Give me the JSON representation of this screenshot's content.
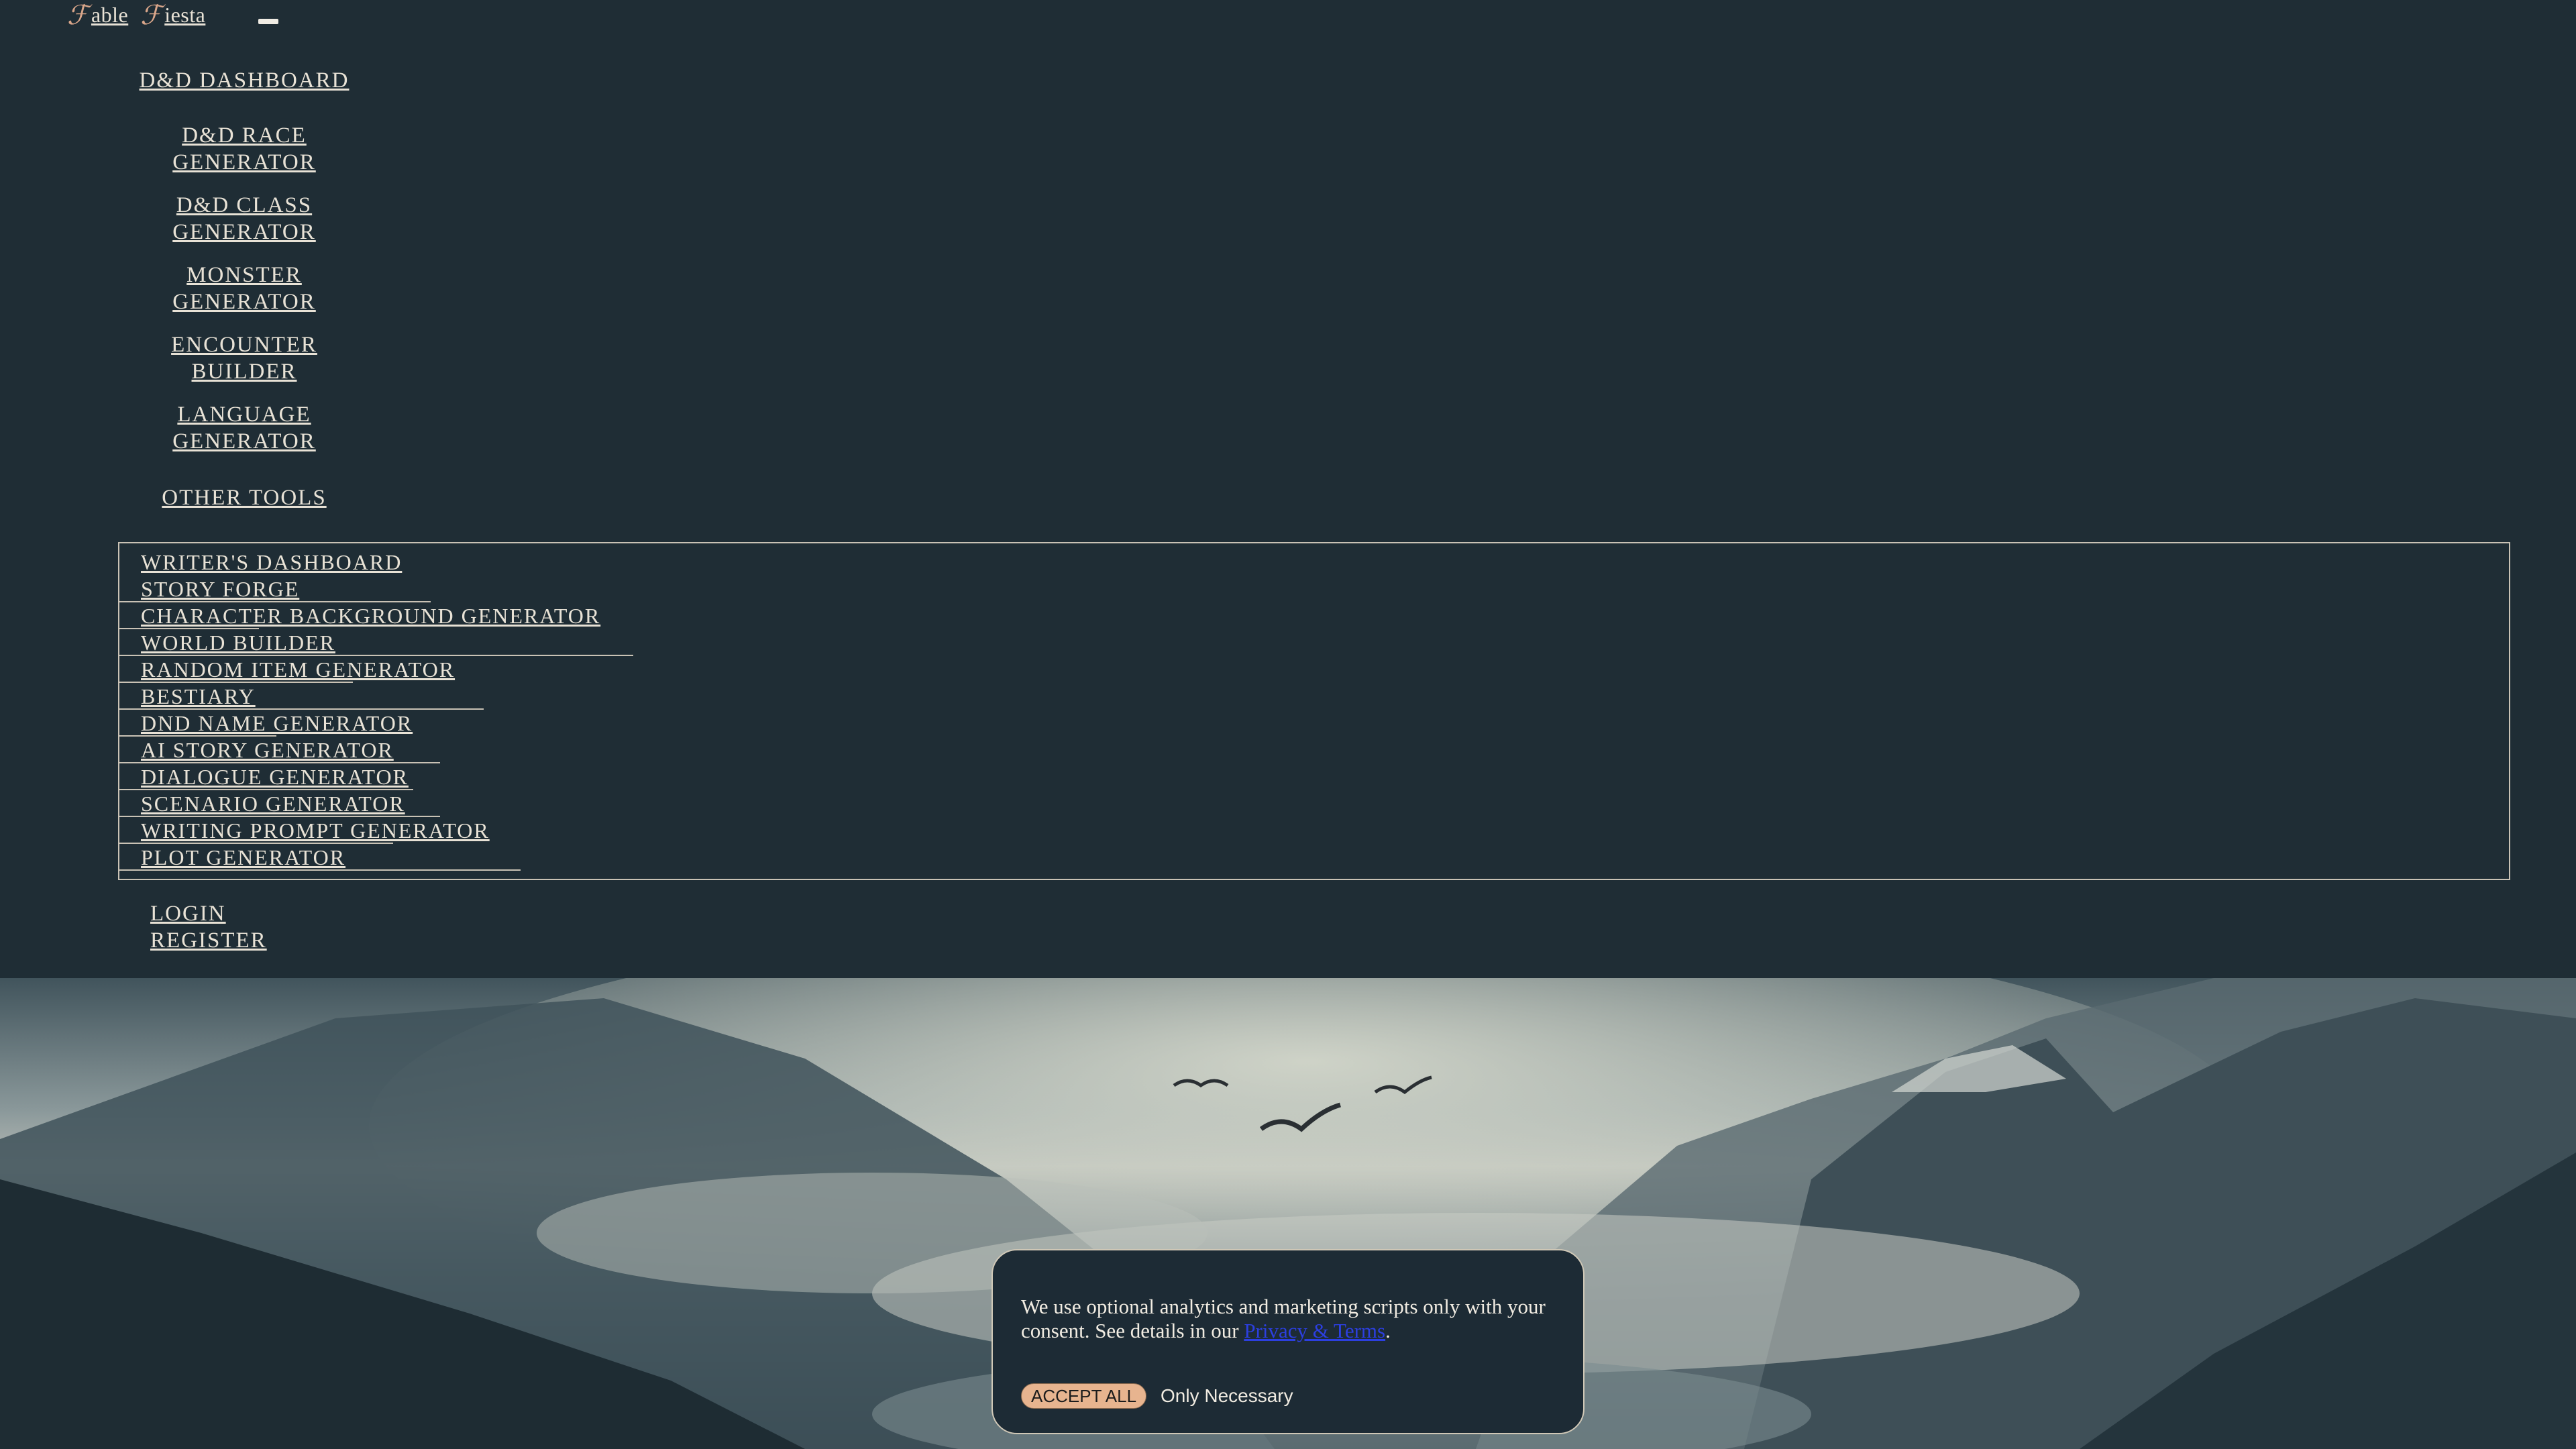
{
  "brand": {
    "glyph": "ℱ",
    "word1": "able",
    "word2": "iesta"
  },
  "nav": {
    "dashboard": "D&D DASHBOARD",
    "race_1": "D&D RACE",
    "race_2": "GENERATOR",
    "class_1": "D&D CLASS",
    "class_2": "GENERATOR",
    "monster_1": "MONSTER",
    "monster_2": "GENERATOR",
    "encounter_1": "ENCOUNTER",
    "encounter_2": "BUILDER",
    "language_1": "LANGUAGE",
    "language_2": "GENERATOR",
    "other_tools": "OTHER TOOLS"
  },
  "tools": {
    "writers_dashboard": "WRITER'S DASHBOARD",
    "items": [
      "STORY FORGE",
      "CHARACTER BACKGROUND GENERATOR",
      "WORLD BUILDER",
      "RANDOM ITEM GENERATOR",
      "BESTIARY",
      "DND NAME GENERATOR",
      "AI STORY GENERATOR",
      "DIALOGUE GENERATOR",
      "SCENARIO GENERATOR",
      "WRITING PROMPT GENERATOR",
      "PLOT GENERATOR"
    ]
  },
  "auth": {
    "login": "LOGIN",
    "register": "REGISTER"
  },
  "cookie": {
    "message": "We use optional analytics and marketing scripts only with your consent. See details in our ",
    "link": "Privacy & Terms",
    "period": ".",
    "accept": "ACCEPT ALL",
    "only_necessary": "Only Necessary"
  }
}
